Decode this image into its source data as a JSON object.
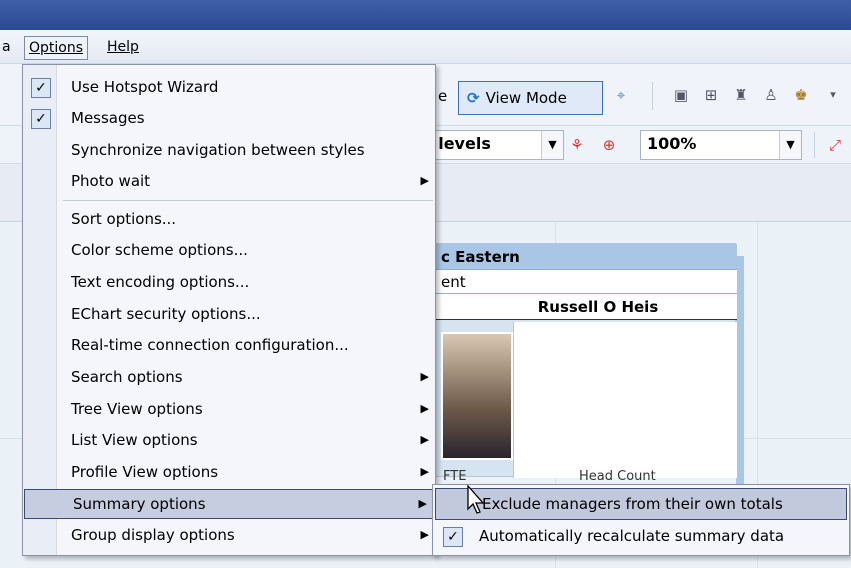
{
  "menubar": {
    "cut_item": "a",
    "options": "Options",
    "help": "Help"
  },
  "toolbar": {
    "view_mode_prefix": "e",
    "view_mode_label": "View Mode",
    "levels_combo": "t levels",
    "zoom_combo": "100%"
  },
  "card": {
    "header": "c Eastern",
    "dept": "ent",
    "name": "Russell O Heis",
    "col1": "FTE",
    "col2": "Head Count"
  },
  "options_menu": {
    "items": [
      {
        "label": "Use Hotspot Wizard",
        "checked": true
      },
      {
        "label": "Messages",
        "checked": true
      },
      {
        "label": "Synchronize navigation between styles"
      },
      {
        "label": "Photo wait",
        "submenu": true
      },
      {
        "label": "Sort options..."
      },
      {
        "label": "Color scheme options..."
      },
      {
        "label": "Text encoding options..."
      },
      {
        "label": "EChart security options..."
      },
      {
        "label": "Real-time connection configuration..."
      },
      {
        "label": "Search options",
        "submenu": true
      },
      {
        "label": "Tree View options",
        "submenu": true
      },
      {
        "label": "List View options",
        "submenu": true
      },
      {
        "label": "Profile View options",
        "submenu": true
      },
      {
        "label": "Summary options",
        "submenu": true,
        "highlighted": true
      },
      {
        "label": "Group display options",
        "submenu": true
      }
    ]
  },
  "summary_submenu": {
    "items": [
      {
        "label": "Exclude managers from their own totals",
        "highlighted": true
      },
      {
        "label": "Automatically recalculate summary data",
        "checked": true
      }
    ]
  },
  "colors": {
    "titlebar": "#2c4a94",
    "highlight": "#c6cde0",
    "card_header": "#a9c6e6"
  }
}
